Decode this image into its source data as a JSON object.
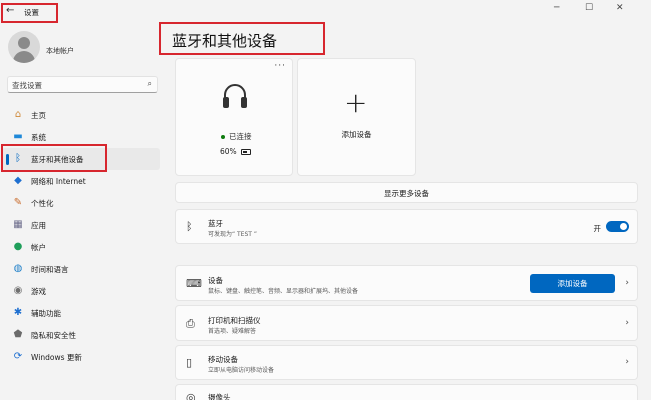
{
  "window": {
    "title": "设置",
    "back_icon": "←",
    "minimize_icon": "─",
    "maximize_icon": "☐",
    "close_icon": "✕"
  },
  "account": {
    "name": "本地帐户"
  },
  "search": {
    "placeholder": "查找设置"
  },
  "sidebar": {
    "items": [
      {
        "label": "主页",
        "icon": "home-icon",
        "glyph": "⌂",
        "color": "#d08a3a"
      },
      {
        "label": "系统",
        "icon": "monitor-icon",
        "glyph": "▬",
        "color": "#1e88d8"
      },
      {
        "label": "蓝牙和其他设备",
        "icon": "bluetooth-icon",
        "glyph": "ᛒ",
        "color": "#0067c0",
        "selected": true
      },
      {
        "label": "网络和 Internet",
        "icon": "wifi-icon",
        "glyph": "◆",
        "color": "#1e6fd0"
      },
      {
        "label": "个性化",
        "icon": "brush-icon",
        "glyph": "✎",
        "color": "#c86a2a"
      },
      {
        "label": "应用",
        "icon": "apps-icon",
        "glyph": "▦",
        "color": "#6b6b8a"
      },
      {
        "label": "帐户",
        "icon": "account-icon",
        "glyph": "●",
        "color": "#1f9e5a"
      },
      {
        "label": "时间和语言",
        "icon": "globe-icon",
        "glyph": "◍",
        "color": "#1e7fc8"
      },
      {
        "label": "游戏",
        "icon": "gamepad-icon",
        "glyph": "◉",
        "color": "#707070"
      },
      {
        "label": "辅助功能",
        "icon": "accessibility-icon",
        "glyph": "✱",
        "color": "#1e6fd0"
      },
      {
        "label": "隐私和安全性",
        "icon": "shield-icon",
        "glyph": "⬟",
        "color": "#6b6b6b"
      },
      {
        "label": "Windows 更新",
        "icon": "update-icon",
        "glyph": "⟳",
        "color": "#1e6fd0"
      }
    ]
  },
  "main": {
    "title": "蓝牙和其他设备",
    "device_card": {
      "status": "已连接",
      "battery": "60%",
      "menu_icon": "···"
    },
    "add_card": {
      "plus": "+",
      "label": "添加设备"
    },
    "show_more": "显示更多设备",
    "bluetooth": {
      "title": "蓝牙",
      "subtitle": "可发现为“ TEST ”",
      "toggle_label": "开",
      "on": true
    },
    "devices_row": {
      "title": "设备",
      "subtitle": "鼠标、键盘、触控笔、音频、显示器和扩展坞、其他设备",
      "button": "添加设备"
    },
    "printers_row": {
      "title": "打印机和扫描仪",
      "subtitle": "首选项、疑难解答"
    },
    "mobile_row": {
      "title": "移动设备",
      "subtitle": "立即从电脑访问移动设备"
    },
    "camera_row": {
      "title": "摄像头"
    }
  },
  "colors": {
    "accent": "#0067c0",
    "highlight_border": "#d7262e"
  }
}
